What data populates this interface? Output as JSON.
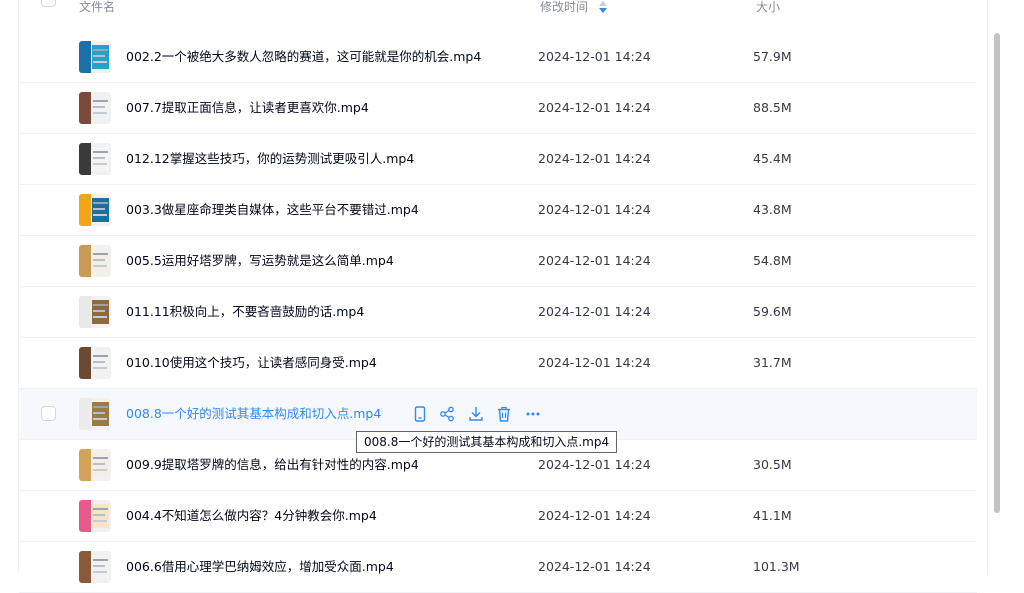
{
  "header": {
    "name_label": "文件名",
    "mtime_label": "修改时间",
    "size_label": "大小"
  },
  "files": [
    {
      "name": "002.2一个被绝大多数人忽略的赛道，这可能就是你的机会.mp4",
      "mtime": "2024-12-01 14:24",
      "size": "57.9M",
      "thumb": [
        "#1d6fa8",
        "#27a2c7"
      ]
    },
    {
      "name": "007.7提取正面信息，让读者更喜欢你.mp4",
      "mtime": "2024-12-01 14:24",
      "size": "88.5M",
      "thumb": [
        "#7a4a3a",
        "#f2f2f2"
      ]
    },
    {
      "name": "012.12掌握这些技巧，你的运势测试更吸引人.mp4",
      "mtime": "2024-12-01 14:24",
      "size": "45.4M",
      "thumb": [
        "#3a3a3a",
        "#f4f4f4"
      ]
    },
    {
      "name": "003.3做星座命理类自媒体，这些平台不要错过.mp4",
      "mtime": "2024-12-01 14:24",
      "size": "43.8M",
      "thumb": [
        "#f2a516",
        "#1c6f9b"
      ]
    },
    {
      "name": "005.5运用好塔罗牌，写运势就是这么简单.mp4",
      "mtime": "2024-12-01 14:24",
      "size": "54.8M",
      "thumb": [
        "#c79a55",
        "#f3efe6"
      ]
    },
    {
      "name": "011.11积极向上，不要吝啬鼓励的话.mp4",
      "mtime": "2024-12-01 14:24",
      "size": "59.6M",
      "thumb": [
        "#e9e9e9",
        "#8b6a3e"
      ]
    },
    {
      "name": "010.10使用这个技巧，让读者感同身受.mp4",
      "mtime": "2024-12-01 14:24",
      "size": "31.7M",
      "thumb": [
        "#6b4a33",
        "#f2f2f2"
      ]
    },
    {
      "name": "008.8一个好的测试其基本构成和切入点.mp4",
      "mtime": "",
      "size": "",
      "thumb": [
        "#ececec",
        "#9c7a45"
      ],
      "hover": true
    },
    {
      "name": "009.9提取塔罗牌的信息，给出有针对性的内容.mp4",
      "mtime": "2024-12-01 14:24",
      "size": "30.5M",
      "thumb": [
        "#d4a25a",
        "#f3efe6"
      ]
    },
    {
      "name": "004.4不知道怎么做内容？4分钟教会你.mp4",
      "mtime": "2024-12-01 14:24",
      "size": "41.1M",
      "thumb": [
        "#e85a8a",
        "#f5e6c8"
      ]
    },
    {
      "name": "006.6借用心理学巴纳姆效应，增加受众面.mp4",
      "mtime": "2024-12-01 14:24",
      "size": "101.3M",
      "thumb": [
        "#8a5a3a",
        "#f2f2f2"
      ]
    }
  ],
  "tooltip": "008.8一个好的测试其基本构成和切入点.mp4",
  "colors": {
    "accent": "#2f8af5",
    "hover_row": "#f5f8fd",
    "scrollbar": "#c1c3c8"
  },
  "row_actions": [
    "mobile-icon",
    "share-icon",
    "download-icon",
    "delete-icon",
    "more-icon"
  ]
}
